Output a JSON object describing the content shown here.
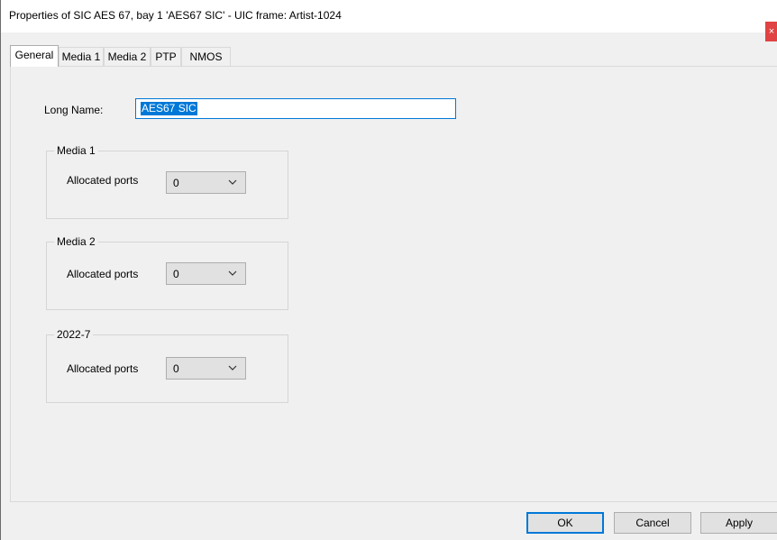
{
  "window": {
    "title": "Properties of SIC AES 67, bay 1 'AES67 SIC' - UIC frame: Artist-1024",
    "close_label": "×"
  },
  "tabs": [
    {
      "label": "General",
      "active": true
    },
    {
      "label": "Media 1",
      "active": false
    },
    {
      "label": "Media 2",
      "active": false
    },
    {
      "label": "PTP",
      "active": false
    },
    {
      "label": "NMOS",
      "active": false
    }
  ],
  "general": {
    "long_name_label": "Long Name:",
    "long_name_value": "AES67 SIC",
    "groups": [
      {
        "title": "Media 1",
        "field_label": "Allocated ports",
        "value": "0"
      },
      {
        "title": "Media 2",
        "field_label": "Allocated ports",
        "value": "0"
      },
      {
        "title": "2022-7",
        "field_label": "Allocated ports",
        "value": "0"
      }
    ]
  },
  "buttons": {
    "ok": "OK",
    "cancel": "Cancel",
    "apply": "Apply"
  },
  "colors": {
    "accent": "#0078d7",
    "close": "#e04343"
  }
}
